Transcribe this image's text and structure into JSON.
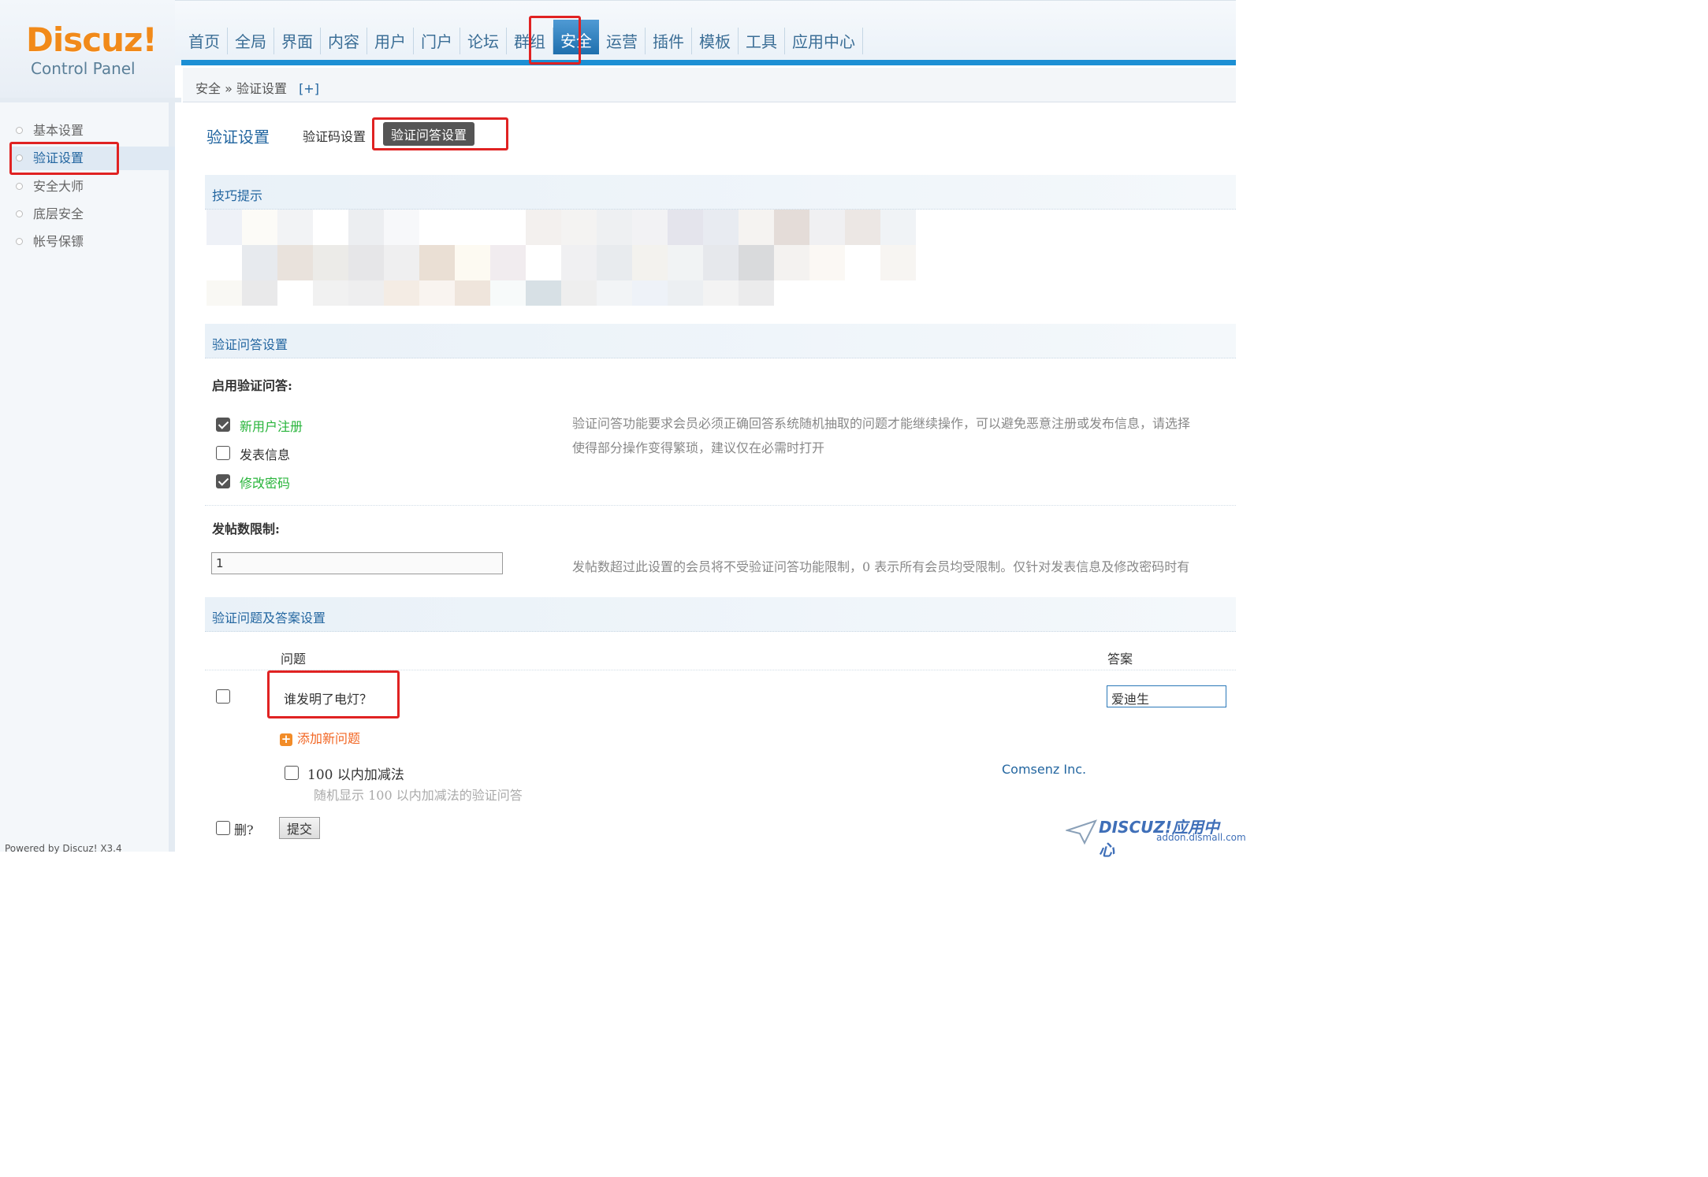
{
  "logo": {
    "brand": "Discuz!",
    "subtitle": "Control Panel"
  },
  "nav": {
    "items": [
      "首页",
      "全局",
      "界面",
      "内容",
      "用户",
      "门户",
      "论坛",
      "群组",
      "安全",
      "运营",
      "插件",
      "模板",
      "工具",
      "应用中心"
    ],
    "active": "安全"
  },
  "breadcrumb": {
    "text": "安全 » 验证设置",
    "expand": "[+]"
  },
  "sidebar": {
    "items": [
      "基本设置",
      "验证设置",
      "安全大师",
      "底层安全",
      "帐号保镖"
    ],
    "active": "验证设置",
    "footer": "Powered by Discuz! X3.4"
  },
  "page": {
    "title": "验证设置",
    "tab_captcha": "验证码设置",
    "tab_qa": "验证问答设置"
  },
  "tips": {
    "heading": "技巧提示"
  },
  "qa_settings": {
    "heading": "验证问答设置",
    "enable_label": "启用验证问答:",
    "options": [
      {
        "label": "新用户注册",
        "checked": true
      },
      {
        "label": "发表信息",
        "checked": false
      },
      {
        "label": "修改密码",
        "checked": true
      }
    ],
    "enable_desc_1": "验证问答功能要求会员必须正确回答系统随机抽取的问题才能继续操作，可以避免恶意注册或发布信息，请选择",
    "enable_desc_2": "使得部分操作变得繁琐，建议仅在必需时打开",
    "post_limit_label": "发帖数限制:",
    "post_limit_value": "1",
    "post_limit_desc": "发帖数超过此设置的会员将不受验证问答功能限制，0 表示所有会员均受限制。仅针对发表信息及修改密码时有"
  },
  "qa_table": {
    "heading": "验证问题及答案设置",
    "col_question": "问题",
    "col_answer": "答案",
    "row_question": "谁发明了电灯？",
    "row_answer": "爱迪生",
    "add_new": "添加新问题",
    "math_label": "100 以内加减法",
    "math_desc": "随机显示 100 以内加减法的验证问答",
    "vendor": "Comsenz Inc.",
    "delete_label": "删?",
    "submit": "提交"
  },
  "watermark": {
    "main": "DISCUZ!应用中心",
    "sub": "addon.dismall.com"
  },
  "colors": {
    "accent": "#1c8fd4",
    "link": "#2366a0",
    "highlight": "#e02222",
    "green": "#27b43a",
    "orange": "#f26522"
  }
}
